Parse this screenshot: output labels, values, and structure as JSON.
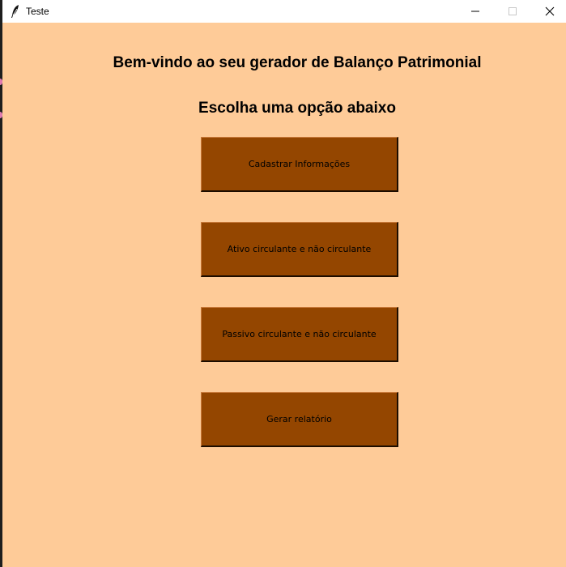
{
  "window": {
    "title": "Teste",
    "icon": "feather-icon",
    "controls": [
      "minimize-icon",
      "maximize-icon",
      "close-icon"
    ]
  },
  "main": {
    "heading": "Bem-vindo ao seu gerador de Balanço Patrimonial",
    "subheading": "Escolha uma opção abaixo",
    "buttons": [
      {
        "label": "Cadastrar Informações"
      },
      {
        "label": "Ativo circulante e não circulante"
      },
      {
        "label": "Passivo circulante e não circulante"
      },
      {
        "label": "Gerar relatório"
      }
    ]
  },
  "colors": {
    "background": "#fecb98",
    "button": "#944600",
    "titlebar": "#ffffff"
  }
}
